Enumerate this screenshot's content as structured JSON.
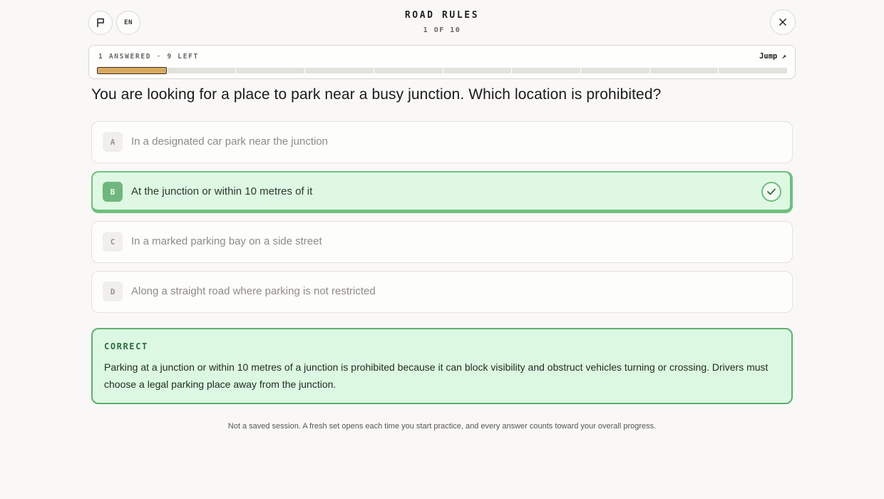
{
  "header": {
    "title": "ROAD RULES",
    "counter": "1 OF 10",
    "language": "EN",
    "flag_icon": "flag-icon",
    "close_icon": "close-icon"
  },
  "progress": {
    "status": "1 ANSWERED · 9 LEFT",
    "jump_label": "Jump ↗",
    "total": 10,
    "answered": 1,
    "answered_color": "#d9a95c"
  },
  "question": {
    "text": "You are looking for a place to park near a busy junction. Which location is prohibited?",
    "options": [
      {
        "letter": "A",
        "text": "In a designated car park near the junction",
        "state": "unselected"
      },
      {
        "letter": "B",
        "text": "At the junction or within 10 metres of it",
        "state": "correct"
      },
      {
        "letter": "C",
        "text": "In a marked parking bay on a side street",
        "state": "unselected"
      },
      {
        "letter": "D",
        "text": "Along a straight road where parking is not restricted",
        "state": "unselected"
      }
    ]
  },
  "feedback": {
    "title": "CORRECT",
    "text": "Parking at a junction or within 10 metres of a junction is prohibited because it can block visibility and obstruct vehicles turning or crossing. Drivers must choose a legal parking place away from the junction."
  },
  "footnote": "Not a saved session. A fresh set opens each time you start practice, and every answer counts toward your overall progress.",
  "colors": {
    "accent_green": "#6fbf7e",
    "correct_bg": "#dff8e4",
    "progress_fill": "#d9a95c"
  }
}
